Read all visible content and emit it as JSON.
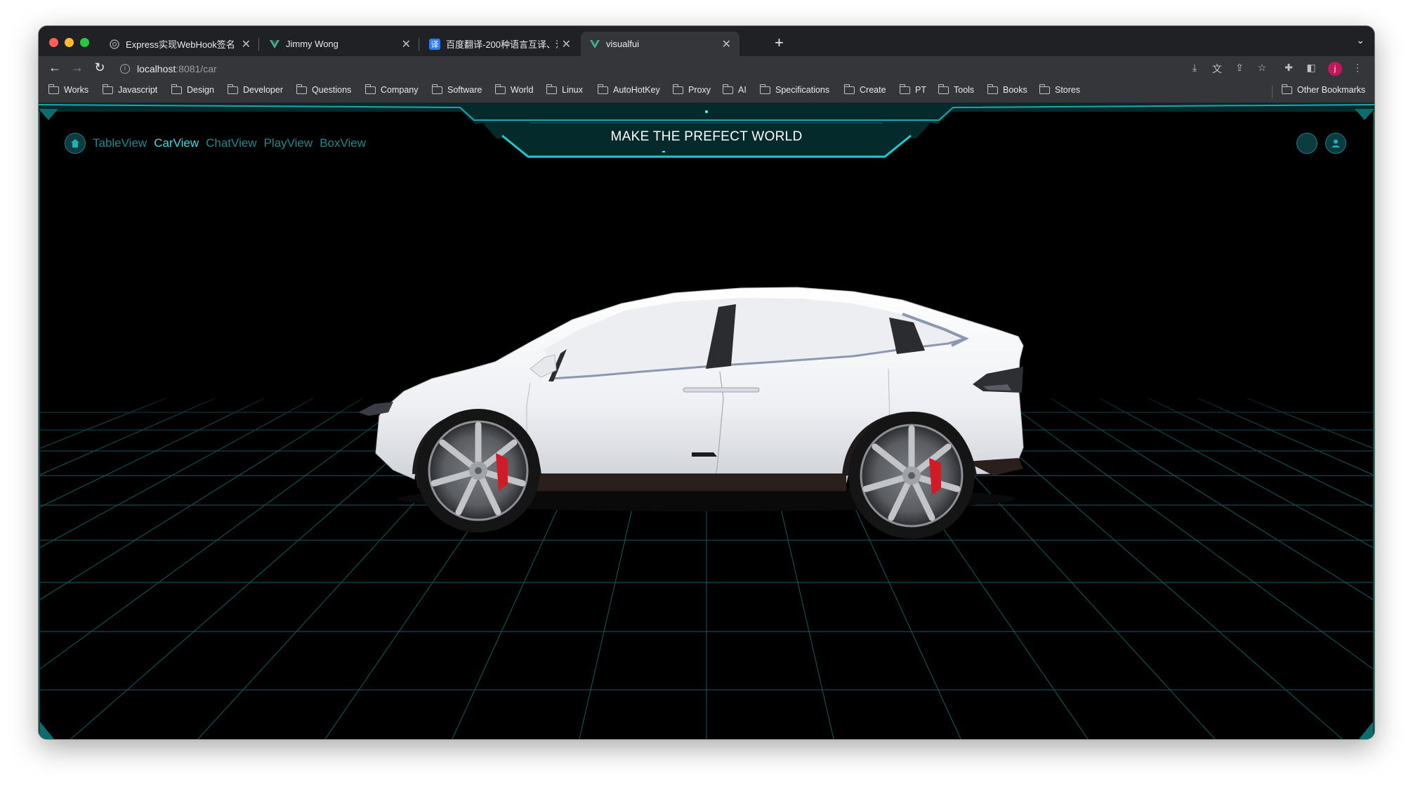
{
  "browser": {
    "tabs": [
      {
        "title": "Express实现WebHook签名",
        "favicon": "openai-icon",
        "active": false
      },
      {
        "title": "Jimmy Wong",
        "favicon": "vue-icon",
        "active": false
      },
      {
        "title": "百度翻译-200种语言互译、沟通",
        "favicon": "baidu-translate-icon",
        "favicon_text": "译",
        "active": false
      },
      {
        "title": "visualfui",
        "favicon": "vue-icon",
        "active": true
      }
    ],
    "url": {
      "host": "localhost",
      "rest": ":8081/car"
    },
    "profile_initial": "j",
    "bookmarks": [
      "Works",
      "Javascript",
      "Design",
      "Developer",
      "Questions",
      "Company",
      "Software",
      "World",
      "Linux",
      "AutoHotKey",
      "Proxy",
      "AI",
      "Specifications",
      "Create",
      "PT",
      "Tools",
      "Books",
      "Stores"
    ],
    "other_bookmarks": "Other Bookmarks"
  },
  "app": {
    "title": "MAKE THE PREFECT WORLD",
    "nav": [
      {
        "label": "TableView",
        "active": false
      },
      {
        "label": "CarView",
        "active": true
      },
      {
        "label": "ChatView",
        "active": false
      },
      {
        "label": "PlayView",
        "active": false
      },
      {
        "label": "BoxView",
        "active": false
      }
    ],
    "accent_color": "#2ee1e6",
    "grid_color": "#0f5f62",
    "scene_object": "white-suv-3d-model"
  }
}
